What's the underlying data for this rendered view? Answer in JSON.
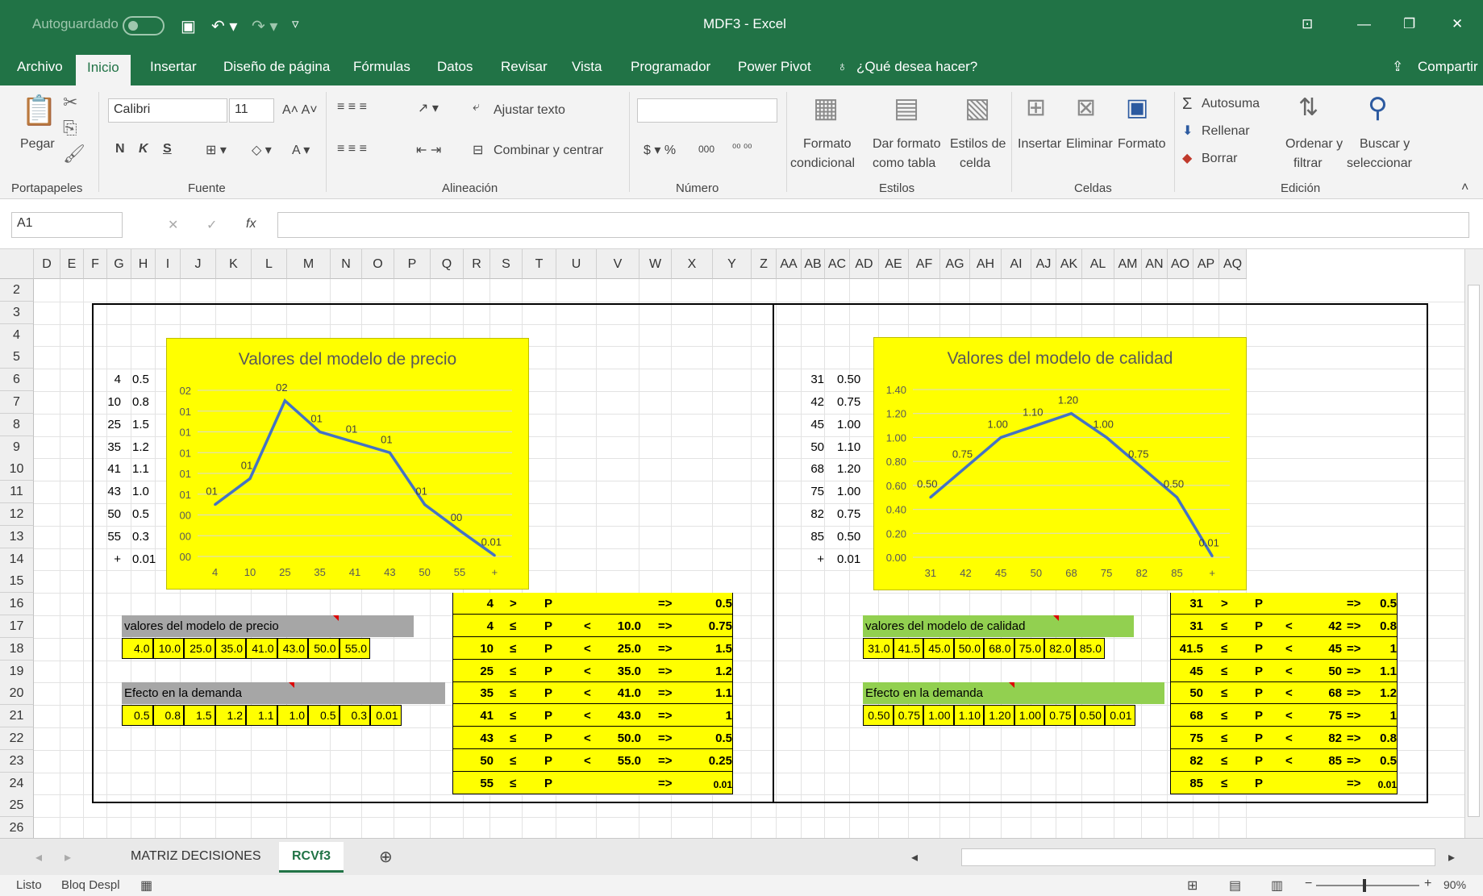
{
  "window": {
    "autosave": "Autoguardado",
    "title": "MDF3  -  Excel"
  },
  "ribbon_tabs": [
    "Archivo",
    "Inicio",
    "Insertar",
    "Diseño de página",
    "Fórmulas",
    "Datos",
    "Revisar",
    "Vista",
    "Programador",
    "Power Pivot"
  ],
  "tell_me": "¿Qué desea hacer?",
  "share": "Compartir",
  "ribbon": {
    "paste": "Pegar",
    "font": "Calibri",
    "size": "11",
    "bold": "N",
    "italic": "K",
    "underline": "S",
    "wrap": "Ajustar texto",
    "merge": "Combinar y centrar",
    "cond1": "Formato",
    "cond2": "condicional",
    "fmt1": "Dar formato",
    "fmt2": "como tabla",
    "sty1": "Estilos de",
    "sty2": "celda",
    "insert": "Insertar",
    "delete": "Eliminar",
    "format": "Formato",
    "autosum": "Autosuma",
    "fill": "Rellenar",
    "clear": "Borrar",
    "sort1": "Ordenar y",
    "sort2": "filtrar",
    "find1": "Buscar y",
    "find2": "seleccionar",
    "groups": [
      "Portapapeles",
      "Fuente",
      "Alineación",
      "Número",
      "Estilos",
      "Celdas",
      "Edición"
    ]
  },
  "formula": {
    "namebox": "A1",
    "fx": "fx",
    "value": ""
  },
  "columns": [
    "D",
    "E",
    "F",
    "G",
    "H",
    "I",
    "J",
    "K",
    "L",
    "M",
    "N",
    "O",
    "P",
    "Q",
    "R",
    "S",
    "T",
    "U",
    "V",
    "W",
    "X",
    "Y",
    "Z",
    "AA",
    "AB",
    "AC",
    "AD",
    "AE",
    "AF",
    "AG",
    "AH",
    "AI",
    "AJ",
    "AK",
    "AL",
    "AM",
    "AN",
    "AO",
    "AP",
    "AQ"
  ],
  "rows": [
    "2",
    "3",
    "4",
    "5",
    "6",
    "7",
    "8",
    "9",
    "10",
    "11",
    "12",
    "13",
    "14",
    "15",
    "16",
    "17",
    "18",
    "19",
    "20",
    "21",
    "22",
    "23",
    "24",
    "25",
    "26"
  ],
  "left_list": [
    [
      "4",
      "0.5"
    ],
    [
      "10",
      "0.8"
    ],
    [
      "25",
      "1.5"
    ],
    [
      "35",
      "1.2"
    ],
    [
      "41",
      "1.1"
    ],
    [
      "43",
      "1.0"
    ],
    [
      "50",
      "0.5"
    ],
    [
      "55",
      "0.3"
    ],
    [
      "+",
      "0.01"
    ]
  ],
  "right_list": [
    [
      "31",
      "0.50"
    ],
    [
      "42",
      "0.75"
    ],
    [
      "45",
      "1.00"
    ],
    [
      "50",
      "1.10"
    ],
    [
      "68",
      "1.20"
    ],
    [
      "75",
      "1.00"
    ],
    [
      "82",
      "0.75"
    ],
    [
      "85",
      "0.50"
    ],
    [
      "+",
      "0.01"
    ]
  ],
  "chart_data": [
    {
      "type": "line",
      "title": "Valores del modelo de precio",
      "categories": [
        "4",
        "10",
        "25",
        "35",
        "41",
        "43",
        "50",
        "55",
        "+"
      ],
      "series": [
        {
          "values": [
            0.5,
            0.75,
            1.5,
            1.2,
            1.1,
            1.0,
            0.5,
            0.25,
            0.01
          ]
        }
      ],
      "data_labels": [
        "01",
        "01",
        "02",
        "01",
        "01",
        "01",
        "01",
        "00",
        "0.01"
      ],
      "y_tick_labels": [
        "02",
        "01",
        "01",
        "01",
        "01",
        "01",
        "00",
        "00",
        "00"
      ],
      "grid": true,
      "legend": "none",
      "line_color": "#4472C4",
      "background": "#FFFF00"
    },
    {
      "type": "line",
      "title": "Valores del modelo de calidad",
      "categories": [
        "31",
        "42",
        "45",
        "50",
        "68",
        "75",
        "82",
        "85",
        "+"
      ],
      "series": [
        {
          "values": [
            0.5,
            0.75,
            1.0,
            1.1,
            1.2,
            1.0,
            0.75,
            0.5,
            0.01
          ]
        }
      ],
      "data_labels": [
        "0.50",
        "0.75",
        "1.00",
        "1.10",
        "1.20",
        "1.00",
        "0.75",
        "0.50",
        "0.01"
      ],
      "y_tick_labels": [
        "1.40",
        "1.20",
        "1.00",
        "0.80",
        "0.60",
        "0.40",
        "0.20",
        "0.00"
      ],
      "ylim": [
        0,
        1.4
      ],
      "grid": true,
      "legend": "none",
      "line_color": "#4472C4",
      "background": "#FFFF00"
    }
  ],
  "left_rules": [
    [
      "4",
      ">",
      "P",
      "",
      "",
      "=>",
      "0.5"
    ],
    [
      "4",
      "≤",
      "P",
      "<",
      "10.0",
      "=>",
      "0.75"
    ],
    [
      "10",
      "≤",
      "P",
      "<",
      "25.0",
      "=>",
      "1.5"
    ],
    [
      "25",
      "≤",
      "P",
      "<",
      "35.0",
      "=>",
      "1.2"
    ],
    [
      "35",
      "≤",
      "P",
      "<",
      "41.0",
      "=>",
      "1.1"
    ],
    [
      "41",
      "≤",
      "P",
      "<",
      "43.0",
      "=>",
      "1"
    ],
    [
      "43",
      "≤",
      "P",
      "<",
      "50.0",
      "=>",
      "0.5"
    ],
    [
      "50",
      "≤",
      "P",
      "<",
      "55.0",
      "=>",
      "0.25"
    ],
    [
      "55",
      "≤",
      "P",
      "",
      "",
      "=>",
      "0.01"
    ]
  ],
  "right_rules": [
    [
      "31",
      ">",
      "P",
      "",
      "",
      "=>",
      "0.5"
    ],
    [
      "31",
      "≤",
      "P",
      "<",
      "42",
      "=>",
      "0.8"
    ],
    [
      "41.5",
      "≤",
      "P",
      "<",
      "45",
      "=>",
      "1"
    ],
    [
      "45",
      "≤",
      "P",
      "<",
      "50",
      "=>",
      "1.1"
    ],
    [
      "50",
      "≤",
      "P",
      "<",
      "68",
      "=>",
      "1.2"
    ],
    [
      "68",
      "≤",
      "P",
      "<",
      "75",
      "=>",
      "1"
    ],
    [
      "75",
      "≤",
      "P",
      "<",
      "82",
      "=>",
      "0.8"
    ],
    [
      "82",
      "≤",
      "P",
      "<",
      "85",
      "=>",
      "0.5"
    ],
    [
      "85",
      "≤",
      "P",
      "",
      "",
      "=>",
      "0.01"
    ]
  ],
  "left_strips": {
    "label1": "valores del modelo de precio",
    "vals1": [
      "4.0",
      "10.0",
      "25.0",
      "35.0",
      "41.0",
      "43.0",
      "50.0",
      "55.0"
    ],
    "label2": "Efecto en la demanda",
    "vals2": [
      "0.5",
      "0.8",
      "1.5",
      "1.2",
      "1.1",
      "1.0",
      "0.5",
      "0.3",
      "0.01"
    ]
  },
  "right_strips": {
    "label1": "valores del modelo de calidad",
    "vals1": [
      "31.0",
      "41.5",
      "45.0",
      "50.0",
      "68.0",
      "75.0",
      "82.0",
      "85.0"
    ],
    "label2": "Efecto en la demanda",
    "vals2": [
      "0.50",
      "0.75",
      "1.00",
      "1.10",
      "1.20",
      "1.00",
      "0.75",
      "0.50",
      "0.01"
    ]
  },
  "sheets": [
    "MATRIZ DECISIONES",
    "RCVf3"
  ],
  "status": {
    "ready": "Listo",
    "scroll": "Bloq Despl",
    "zoom": "90%"
  }
}
